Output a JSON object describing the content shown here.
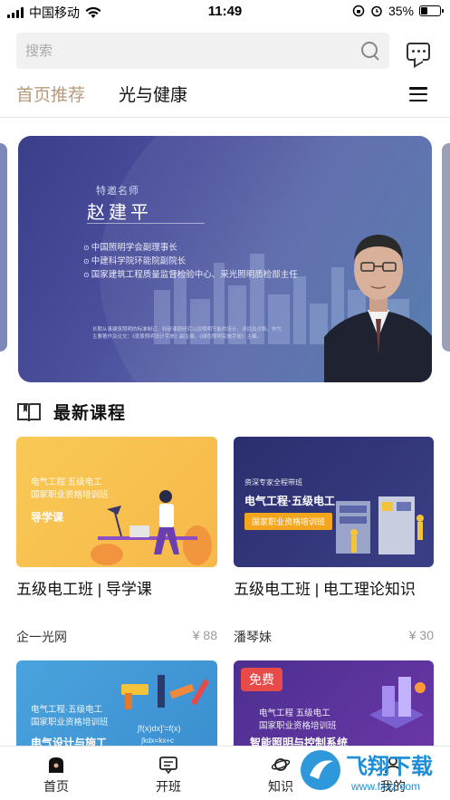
{
  "status_bar": {
    "carrier": "中国移动",
    "time": "11:49",
    "battery": "35%",
    "battery_level": 0.35
  },
  "search": {
    "placeholder": "搜索"
  },
  "tabs": [
    {
      "label": "首页推荐",
      "active": true
    },
    {
      "label": "光与健康",
      "active": false
    }
  ],
  "banner": {
    "subtitle": "特邀名师",
    "name": "赵建平",
    "titles": [
      "中国照明学会副理事长",
      "中建科学院环能院副院长",
      "国家建筑工程质量监督检验中心、采光照明质检部主任"
    ],
    "note": "长期从事建筑照明的标准制订、科研课题研究以及照明节能的设计、评估及诊断。作为主要著作及论文：《夜景照明设计手册》副主编，《绿色照明实施手册》主编。"
  },
  "section": {
    "title": "最新课程"
  },
  "courses": [
    {
      "title": "五级电工班 | 导学课",
      "author": "企一光网",
      "price": "¥ 88",
      "image": {
        "line1": "电气工程 五级电工",
        "line2": "国家职业资格培训班",
        "big": "导学课"
      }
    },
    {
      "title": "五级电工班 | 电工理论知识",
      "author": "潘琴妹",
      "price": "¥ 30",
      "image": {
        "line1": "资深专家全程带班",
        "big": "电气工程·五级电工",
        "badge": "国家职业资格培训班"
      }
    },
    {
      "image": {
        "line1": "电气工程·五级电工",
        "line2": "国家职业资格培训班",
        "big": "电气设计与施工",
        "formula1": "∫f(x)dx]'=f(x)",
        "formula2": "∫kdx=kx+c"
      }
    },
    {
      "image": {
        "badge": "免费",
        "line1": "电气工程 五级电工",
        "line2": "国家职业资格培训班",
        "big": "智能照明与控制系统"
      }
    }
  ],
  "bottom_nav": [
    {
      "label": "首页",
      "icon": "home-icon"
    },
    {
      "label": "开班",
      "icon": "class-icon"
    },
    {
      "label": "知识",
      "icon": "planet-icon"
    },
    {
      "label": "我的",
      "icon": "profile-icon"
    }
  ],
  "watermark": {
    "text": "飞翔下载",
    "url": "www.fxxz.com"
  },
  "colors": {
    "tab_active": "#b79a7a",
    "free_badge": "#e84a4a"
  }
}
